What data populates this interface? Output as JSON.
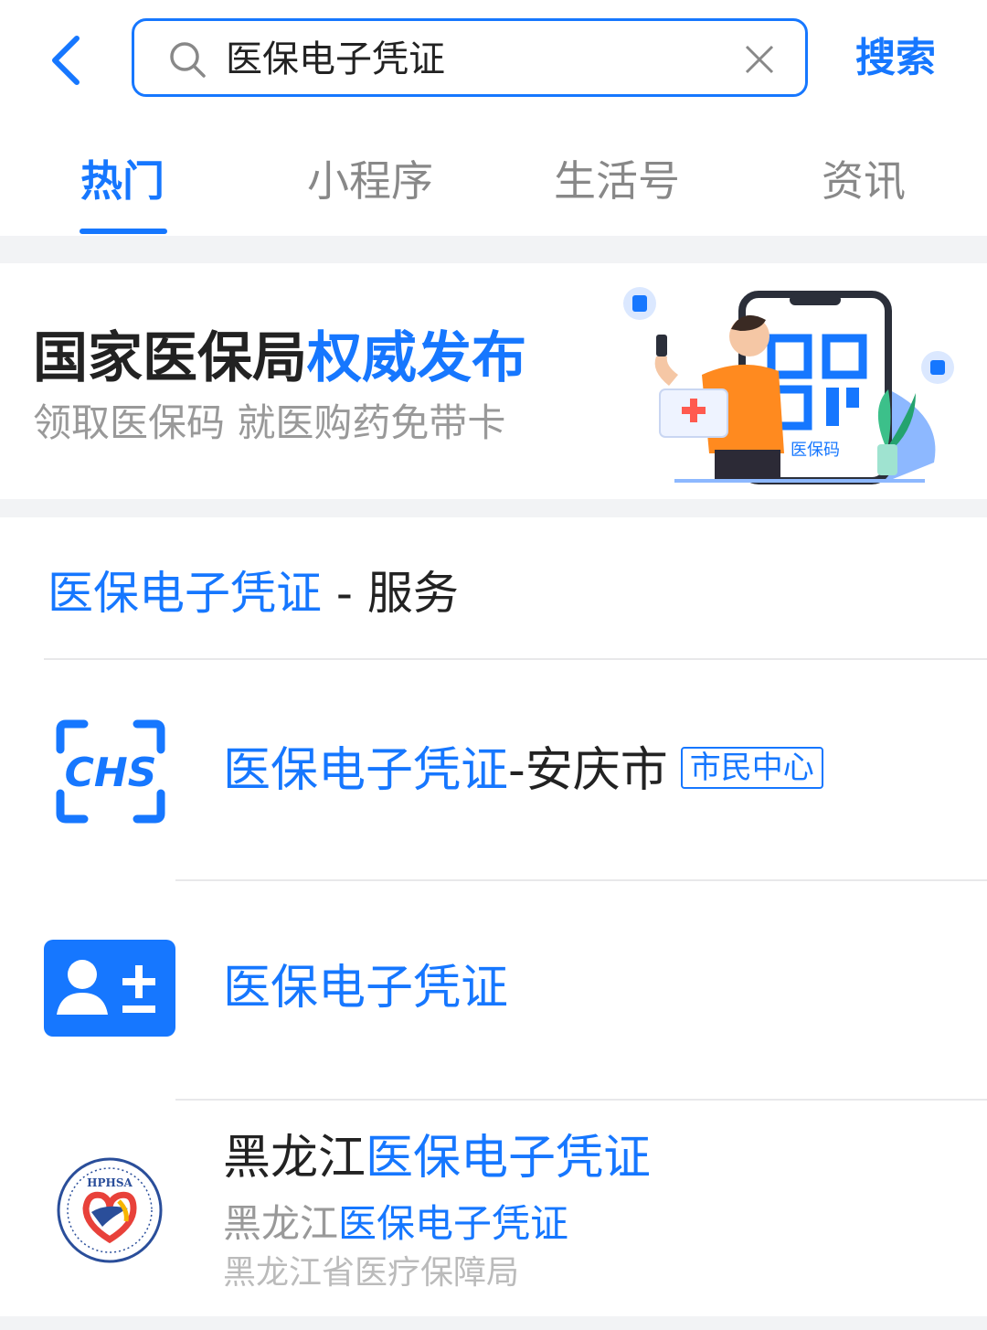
{
  "header": {
    "search_value": "医保电子凭证",
    "search_button": "搜索"
  },
  "tabs": [
    {
      "label": "热门",
      "active": true
    },
    {
      "label": "小程序",
      "active": false
    },
    {
      "label": "生活号",
      "active": false
    },
    {
      "label": "资讯",
      "active": false
    }
  ],
  "banner": {
    "title_black": "国家医保局",
    "title_blue": "权威发布",
    "subtitle": "领取医保码 就医购药免带卡",
    "illustration_label": "医保码"
  },
  "section": {
    "highlight": "医保电子凭证",
    "rest": " - 服务"
  },
  "results": [
    {
      "icon": "chs-logo-icon",
      "title_blue": "医保电子凭证",
      "title_black": "-安庆市",
      "tag": "市民中心"
    },
    {
      "icon": "user-add-icon",
      "title_blue": "医保电子凭证"
    },
    {
      "icon": "hphsa-seal-icon",
      "logo_text": "HPHSA",
      "title_black": "黑龙江",
      "title_blue": "医保电子凭证",
      "sub_black": "黑龙江",
      "sub_blue": "医保电子凭证",
      "org": "黑龙江省医疗保障局"
    }
  ],
  "colors": {
    "accent": "#1677ff",
    "muted": "#999999",
    "background_gap": "#f2f3f5"
  }
}
